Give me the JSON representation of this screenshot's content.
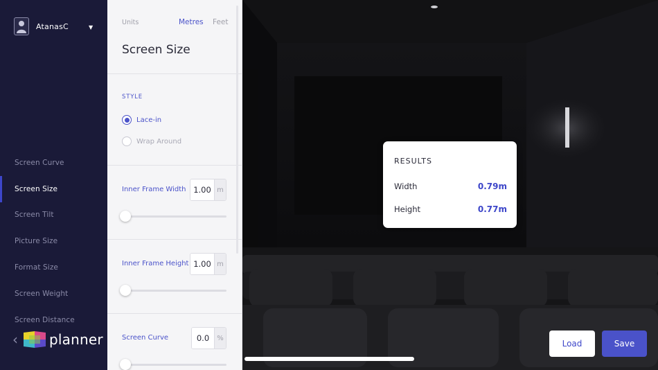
{
  "user": {
    "name": "AtanasC"
  },
  "sidebar": {
    "items": [
      {
        "label": "Screen Curve",
        "active": false
      },
      {
        "label": "Screen Size",
        "active": true
      },
      {
        "label": "Screen Tilt",
        "active": false
      },
      {
        "label": "Picture Size",
        "active": false
      },
      {
        "label": "Format Size",
        "active": false
      },
      {
        "label": "Screen Weight",
        "active": false
      },
      {
        "label": "Screen Distance",
        "active": false
      }
    ],
    "brand": "planner"
  },
  "panel": {
    "units_label": "Units",
    "unit_metres": "Metres",
    "unit_feet": "Feet",
    "selected_unit": "Metres",
    "title": "Screen Size",
    "style_label": "STYLE",
    "style_options": [
      {
        "label": "Lace-in",
        "checked": true
      },
      {
        "label": "Wrap Around",
        "checked": false
      }
    ],
    "fields": [
      {
        "label": "Inner Frame Width",
        "value": "1.00",
        "unit": "m",
        "slider_fraction": 0.0
      },
      {
        "label": "Inner Frame Height",
        "value": "1.00",
        "unit": "m",
        "slider_fraction": 0.0
      },
      {
        "label": "Screen Curve",
        "value": "0.0",
        "unit": "%",
        "slider_fraction": 0.0
      }
    ]
  },
  "results": {
    "title": "RESULTS",
    "rows": [
      {
        "label": "Width",
        "value": "0.79m"
      },
      {
        "label": "Height",
        "value": "0.77m"
      }
    ]
  },
  "actions": {
    "load": "Load",
    "save": "Save"
  },
  "colors": {
    "accent": "#4a52c9",
    "sidebar_bg": "#1a1a38",
    "panel_bg": "#f5f5f7"
  }
}
